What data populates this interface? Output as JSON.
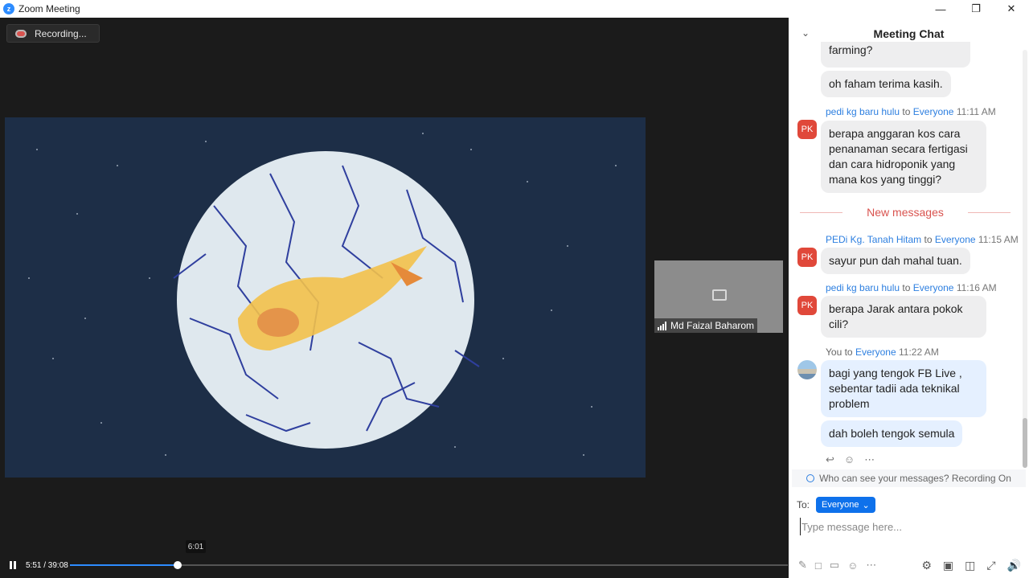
{
  "window": {
    "title": "Zoom Meeting"
  },
  "recording": {
    "label": "Recording..."
  },
  "participant": {
    "name": "Md Faizal Baharom"
  },
  "playback": {
    "hover_time": "6:01",
    "time": "5:51 / 39:08",
    "progress": 0.1495
  },
  "chat": {
    "title": "Meeting Chat",
    "messages": [
      {
        "text": "farming?"
      },
      {
        "text": "oh faham terima kasih."
      },
      {
        "avatar": "PK",
        "sender": "pedi kg baru hulu",
        "to_word": "to",
        "target": "Everyone",
        "time": "11:11 AM",
        "lines": [
          "berapa anggaran kos cara",
          "penanaman secara fertigasi",
          "dan cara hidroponik yang",
          "mana kos yang tinggi?"
        ]
      },
      {
        "avatar": "PK",
        "sender": "PEDi Kg. Tanah Hitam",
        "to_word": "to",
        "target": "Everyone",
        "time": "11:15 AM",
        "lines": [
          "sayur pun dah mahal tuan."
        ]
      },
      {
        "avatar": "PK",
        "sender": "pedi kg baru hulu",
        "to_word": "to",
        "target": "Everyone",
        "time": "11:16 AM",
        "lines": [
          "berapa Jarak antara pokok",
          "cili?"
        ]
      },
      {
        "sender": "You",
        "to_word": "to",
        "target": "Everyone",
        "time": "11:22 AM",
        "lines": [
          "bagi yang tengok FB Live ,",
          "sebentar tadii ada teknikal",
          "problem"
        ]
      },
      {
        "text": "dah boleh tengok semula"
      }
    ],
    "new_messages": "New messages",
    "privacy": "Who can see your messages? Recording On",
    "to_label": "To:",
    "to_value": "Everyone",
    "input_placeholder": "Type message here..."
  },
  "colors": {
    "accent": "#0e71eb",
    "avatar": "#e0483a",
    "new_messages": "#d9534f"
  }
}
